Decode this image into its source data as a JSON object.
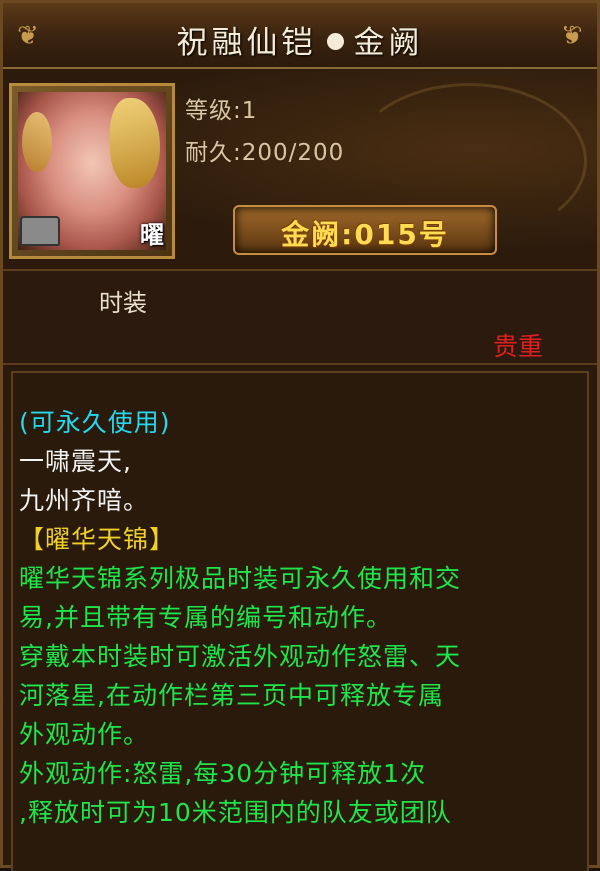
{
  "title": {
    "name": "祝融仙铠",
    "series": "金阙"
  },
  "item": {
    "badge": "曜",
    "level": "等级:1",
    "durability": "耐久:200/200",
    "serial": "金阙:015号",
    "category": "时装",
    "rarity": "贵重",
    "icon": "armor-icon"
  },
  "description": {
    "usage": "(可永久使用)",
    "poem_1": "一啸震天,",
    "poem_2": "九州齐喑。",
    "set_name": "【曜华天锦】",
    "lines": [
      "曜华天锦系列极品时装可永久使用和交",
      "易,并且带有专属的编号和动作。",
      "穿戴本时装时可激活外观动作怒雷、天",
      "河落星,在动作栏第三页中可释放专属",
      "外观动作。",
      "外观动作:怒雷,每30分钟可释放1次",
      ",释放时可为10米范围内的队友或团队"
    ]
  },
  "colors": {
    "usage": "#25d8ee",
    "set_name": "#f0d028",
    "effect_text": "#1ee64a",
    "rarity": "#e02020",
    "serial": "#ffdc52"
  }
}
